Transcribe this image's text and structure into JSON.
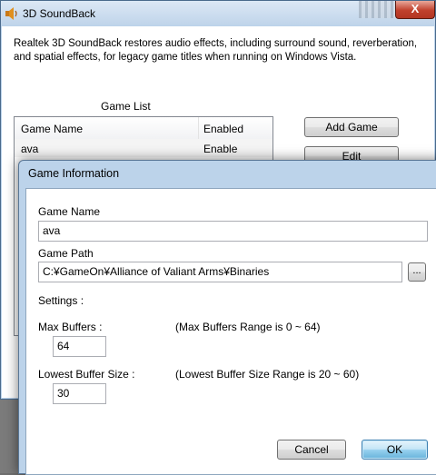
{
  "main_window": {
    "title": "3D SoundBack",
    "close_label": "X",
    "description": "Realtek 3D SoundBack restores audio effects, including surround sound, reverberation, and spatial effects, for legacy game titles when running on Windows Vista.",
    "game_list": {
      "label": "Game List",
      "columns": [
        "Game Name",
        "Enabled"
      ],
      "rows": [
        {
          "name": "ava",
          "enabled": "Enable"
        }
      ]
    },
    "buttons": {
      "add_game": "Add Game",
      "edit": "Edit"
    }
  },
  "dialog": {
    "title": "Game Information",
    "game_name_label": "Game Name",
    "game_name_value": "ava",
    "game_path_label": "Game Path",
    "game_path_value": "C:¥GameOn¥Alliance of Valiant Arms¥Binaries",
    "browse_label": "...",
    "settings_label": "Settings :",
    "max_buffers_label": "Max Buffers :",
    "max_buffers_range": "(Max Buffers Range is 0 ~ 64)",
    "max_buffers_value": "64",
    "lowest_buffer_label": "Lowest Buffer Size :",
    "lowest_buffer_range": "(Lowest Buffer Size Range is 20 ~ 60)",
    "lowest_buffer_value": "30",
    "cancel_label": "Cancel",
    "ok_label": "OK"
  },
  "icons": {
    "app_icon": "speaker-icon"
  }
}
